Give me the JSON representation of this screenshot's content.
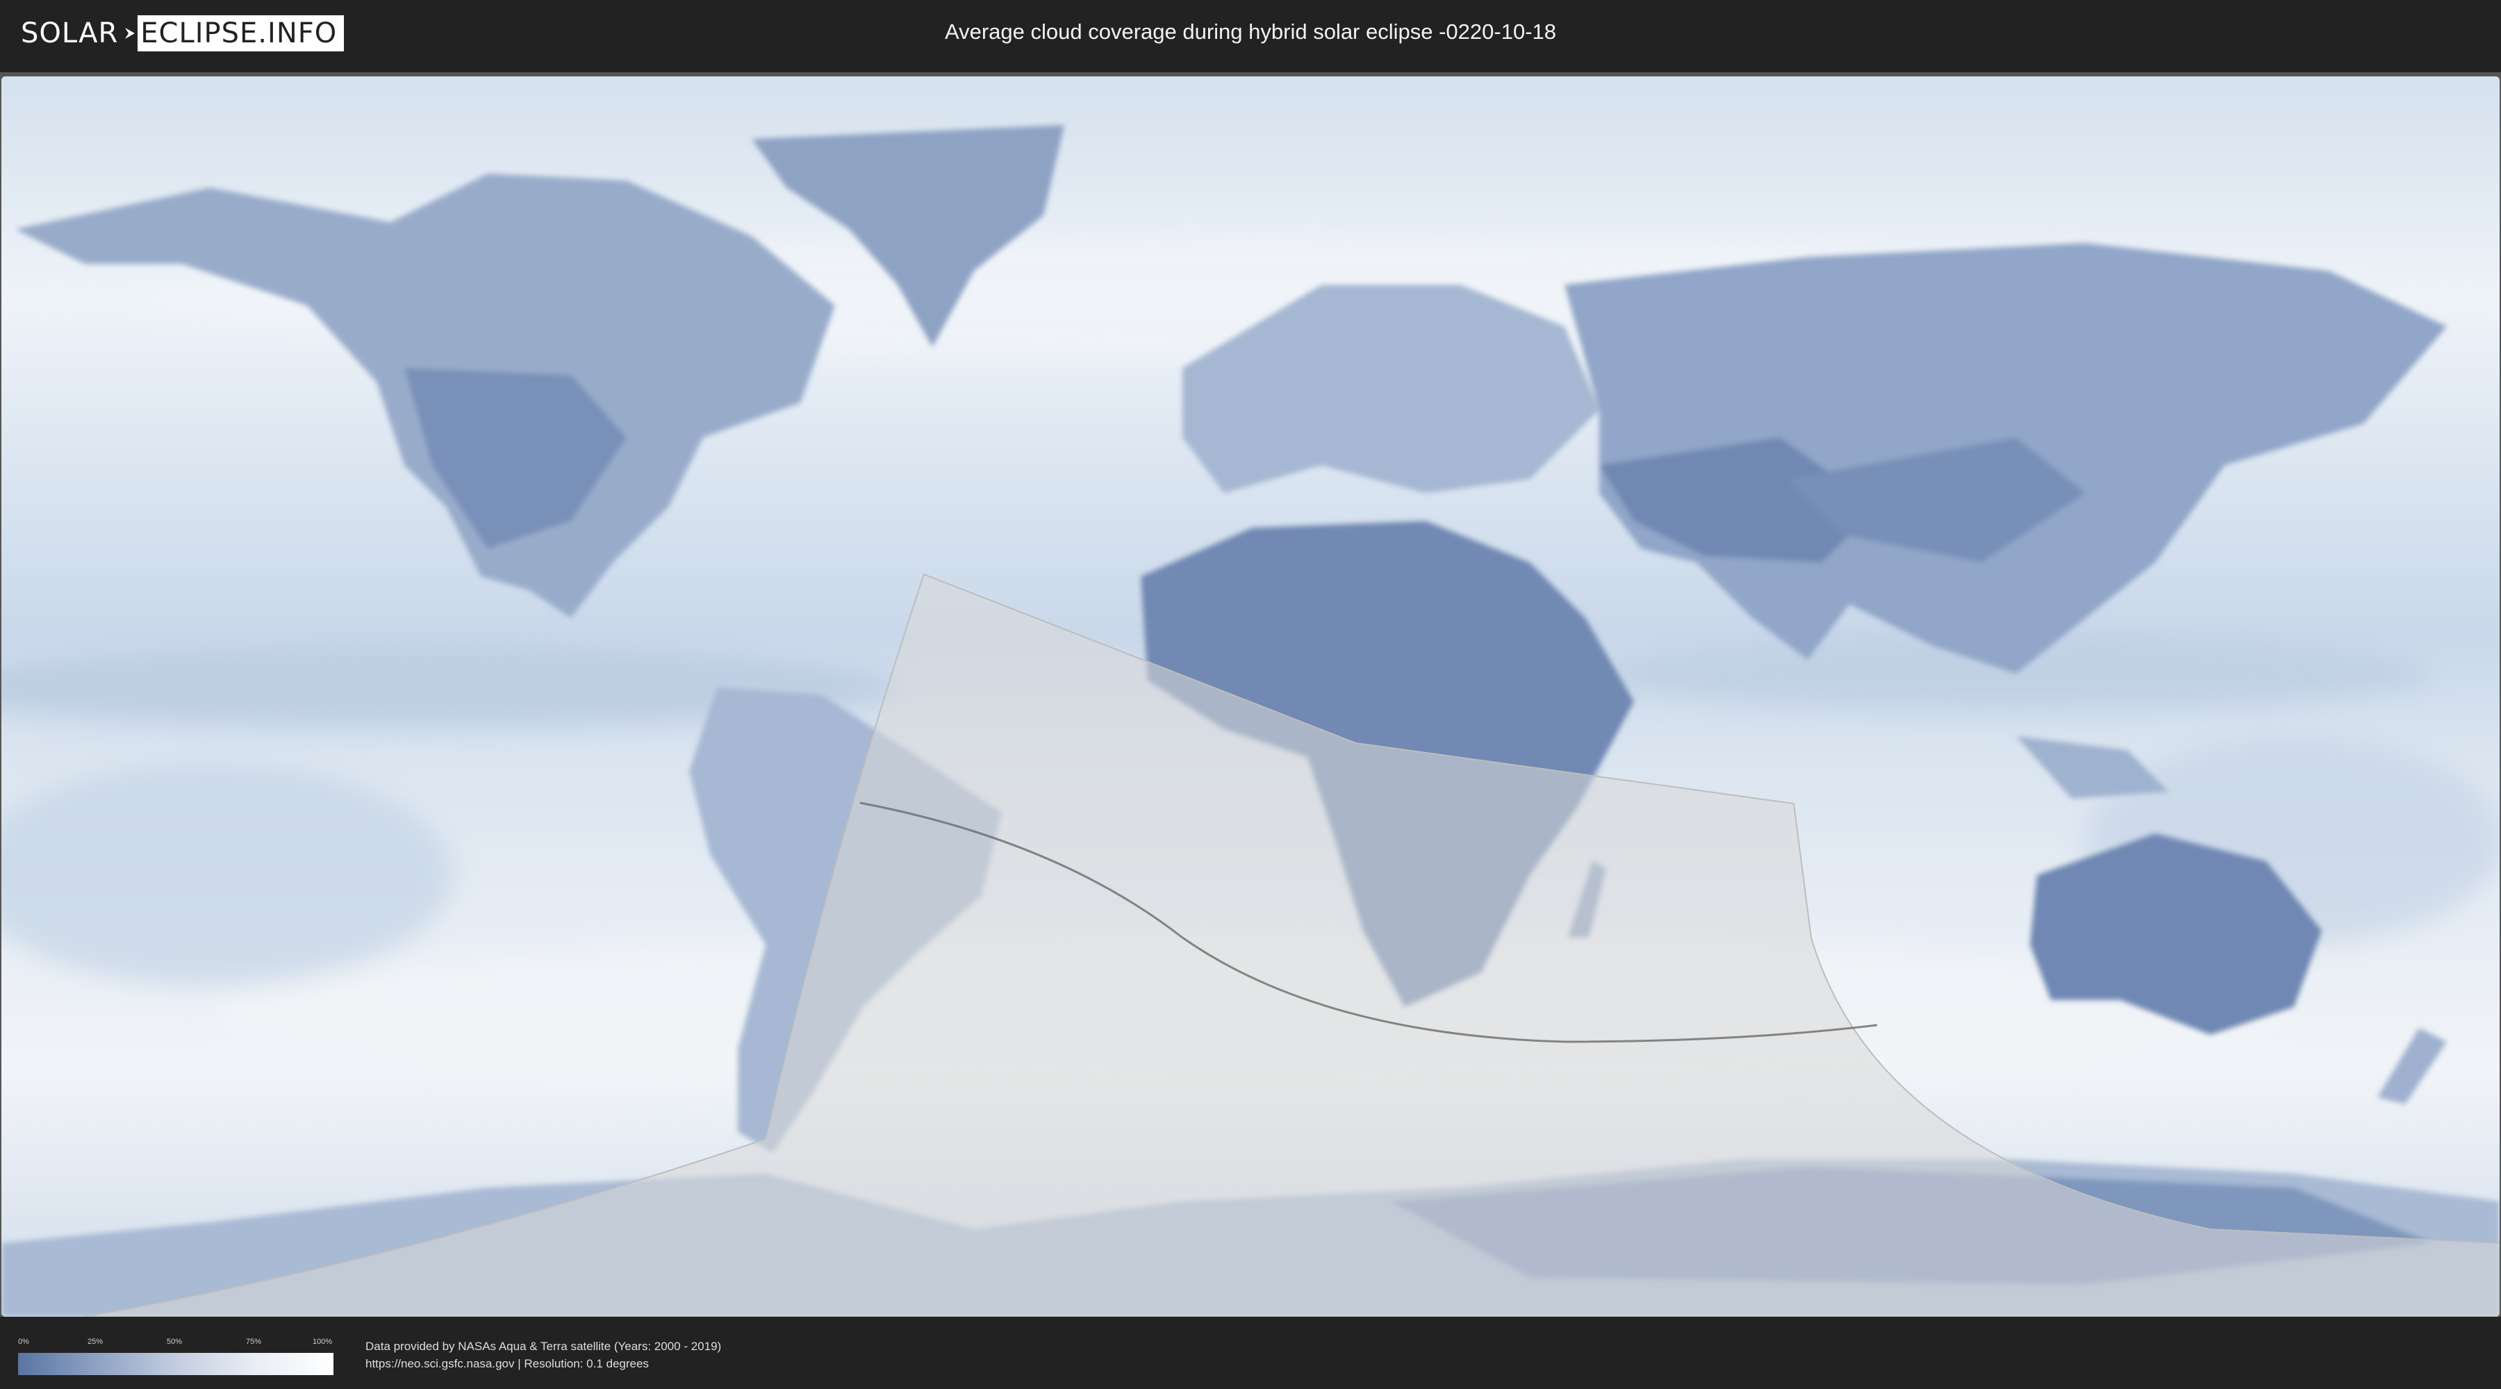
{
  "header": {
    "logo_left": "SOLAR",
    "logo_right": "ECLIPSE.INFO",
    "title": "Average cloud coverage during hybrid solar eclipse -0220-10-18"
  },
  "legend": {
    "stops": [
      "0%",
      "25%",
      "50%",
      "75%",
      "100%"
    ],
    "colors": [
      "#5a75a3",
      "#8ea2c3",
      "#c3cde0",
      "#e9edf4",
      "#ffffff"
    ]
  },
  "footer": {
    "source_line": "Data provided by NASAs Aqua & Terra satellite (Years: 2000 - 2019)",
    "url_line": "https://neo.sci.gsfc.nasa.gov | Resolution: 0.1 degrees"
  },
  "map": {
    "colors": {
      "ocean_cloud": "#dfe7f1",
      "land_clear": "#6f87b1",
      "eclipse_overlay": "#d8d8d8",
      "central_line": "#6a6a6a"
    }
  }
}
